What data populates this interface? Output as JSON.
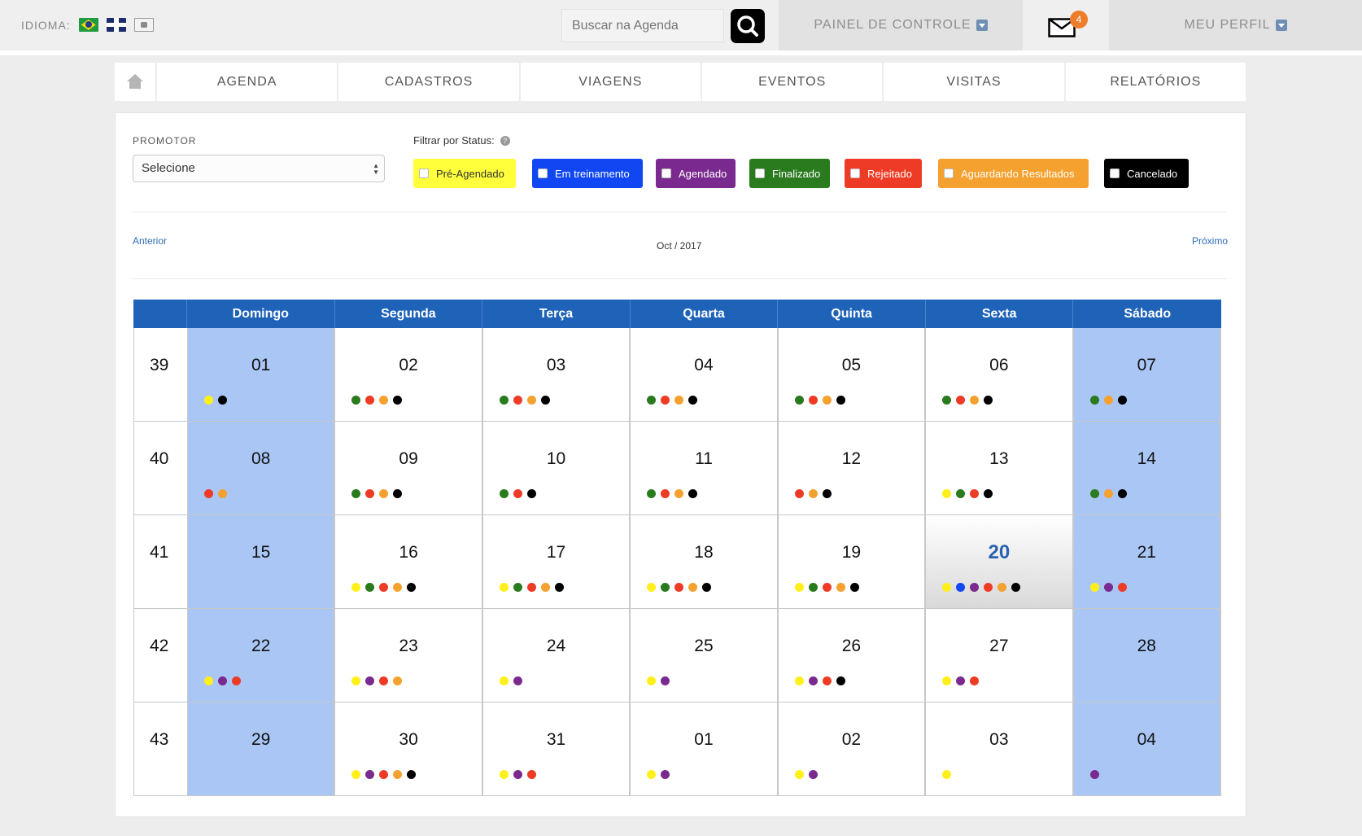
{
  "topbar": {
    "idioma_label": "IDIOMA:",
    "search_placeholder": "Buscar na Agenda",
    "painel_label": "PAINEL DE CONTROLE",
    "mail_count": "4",
    "perfil_label": "MEU PERFIL"
  },
  "nav": [
    "AGENDA",
    "CADASTROS",
    "VIAGENS",
    "EVENTOS",
    "VISITAS",
    "RELATÓRIOS"
  ],
  "filters": {
    "promotor_label": "PROMOTOR",
    "promotor_value": "Selecione",
    "status_label": "Filtrar por Status:",
    "statuses": [
      {
        "label": "Pré-Agendado",
        "color": "#ffff3b",
        "text_color": "#333"
      },
      {
        "label": "Em treinamento",
        "color": "#1047f2",
        "text_color": "#fff"
      },
      {
        "label": "Agendado",
        "color": "#7a2a8e",
        "text_color": "#fff"
      },
      {
        "label": "Finalizado",
        "color": "#2a7a1e",
        "text_color": "#fff"
      },
      {
        "label": "Rejeitado",
        "color": "#ee3b25",
        "text_color": "#fff"
      },
      {
        "label": "Aguardando Resultados",
        "color": "#f5a12f",
        "text_color": "#fff"
      },
      {
        "label": "Cancelado",
        "color": "#000000",
        "text_color": "#fff"
      }
    ]
  },
  "calendar": {
    "prev_label": "Anterior",
    "next_label": "Próximo",
    "month_label": "Oct  /  2017",
    "day_names": [
      "Domingo",
      "Segunda",
      "Terça",
      "Quarta",
      "Quinta",
      "Sexta",
      "Sábado"
    ],
    "dot_colors": {
      "Y": "#ffef1a",
      "B": "#1447f0",
      "P": "#7a2a8e",
      "G": "#2a7a1e",
      "R": "#ee3b25",
      "O": "#f5a12f",
      "K": "#000000"
    },
    "today": "20",
    "weeks": [
      {
        "week": "39",
        "days": [
          {
            "d": "01",
            "dots": "YK"
          },
          {
            "d": "02",
            "dots": "GROK"
          },
          {
            "d": "03",
            "dots": "GROK"
          },
          {
            "d": "04",
            "dots": "GROK"
          },
          {
            "d": "05",
            "dots": "GROK"
          },
          {
            "d": "06",
            "dots": "GROK"
          },
          {
            "d": "07",
            "dots": "GOK"
          }
        ]
      },
      {
        "week": "40",
        "days": [
          {
            "d": "08",
            "dots": "RO"
          },
          {
            "d": "09",
            "dots": "GROK"
          },
          {
            "d": "10",
            "dots": "GRK"
          },
          {
            "d": "11",
            "dots": "GROK"
          },
          {
            "d": "12",
            "dots": "ROK"
          },
          {
            "d": "13",
            "dots": "YGRK"
          },
          {
            "d": "14",
            "dots": "GOK"
          }
        ]
      },
      {
        "week": "41",
        "days": [
          {
            "d": "15",
            "dots": ""
          },
          {
            "d": "16",
            "dots": "YGROK"
          },
          {
            "d": "17",
            "dots": "YGROK"
          },
          {
            "d": "18",
            "dots": "YGROK"
          },
          {
            "d": "19",
            "dots": "YGROK"
          },
          {
            "d": "20",
            "dots": "YBPROK"
          },
          {
            "d": "21",
            "dots": "YPR"
          }
        ]
      },
      {
        "week": "42",
        "days": [
          {
            "d": "22",
            "dots": "YPR"
          },
          {
            "d": "23",
            "dots": "YPRO"
          },
          {
            "d": "24",
            "dots": "YP"
          },
          {
            "d": "25",
            "dots": "YP"
          },
          {
            "d": "26",
            "dots": "YPRK"
          },
          {
            "d": "27",
            "dots": "YPR"
          },
          {
            "d": "28",
            "dots": ""
          }
        ]
      },
      {
        "week": "43",
        "days": [
          {
            "d": "29",
            "dots": ""
          },
          {
            "d": "30",
            "dots": "YPROK"
          },
          {
            "d": "31",
            "dots": "YPR"
          },
          {
            "d": "01",
            "dots": "YP"
          },
          {
            "d": "02",
            "dots": "YP"
          },
          {
            "d": "03",
            "dots": "Y"
          },
          {
            "d": "04",
            "dots": "P"
          }
        ]
      }
    ]
  }
}
